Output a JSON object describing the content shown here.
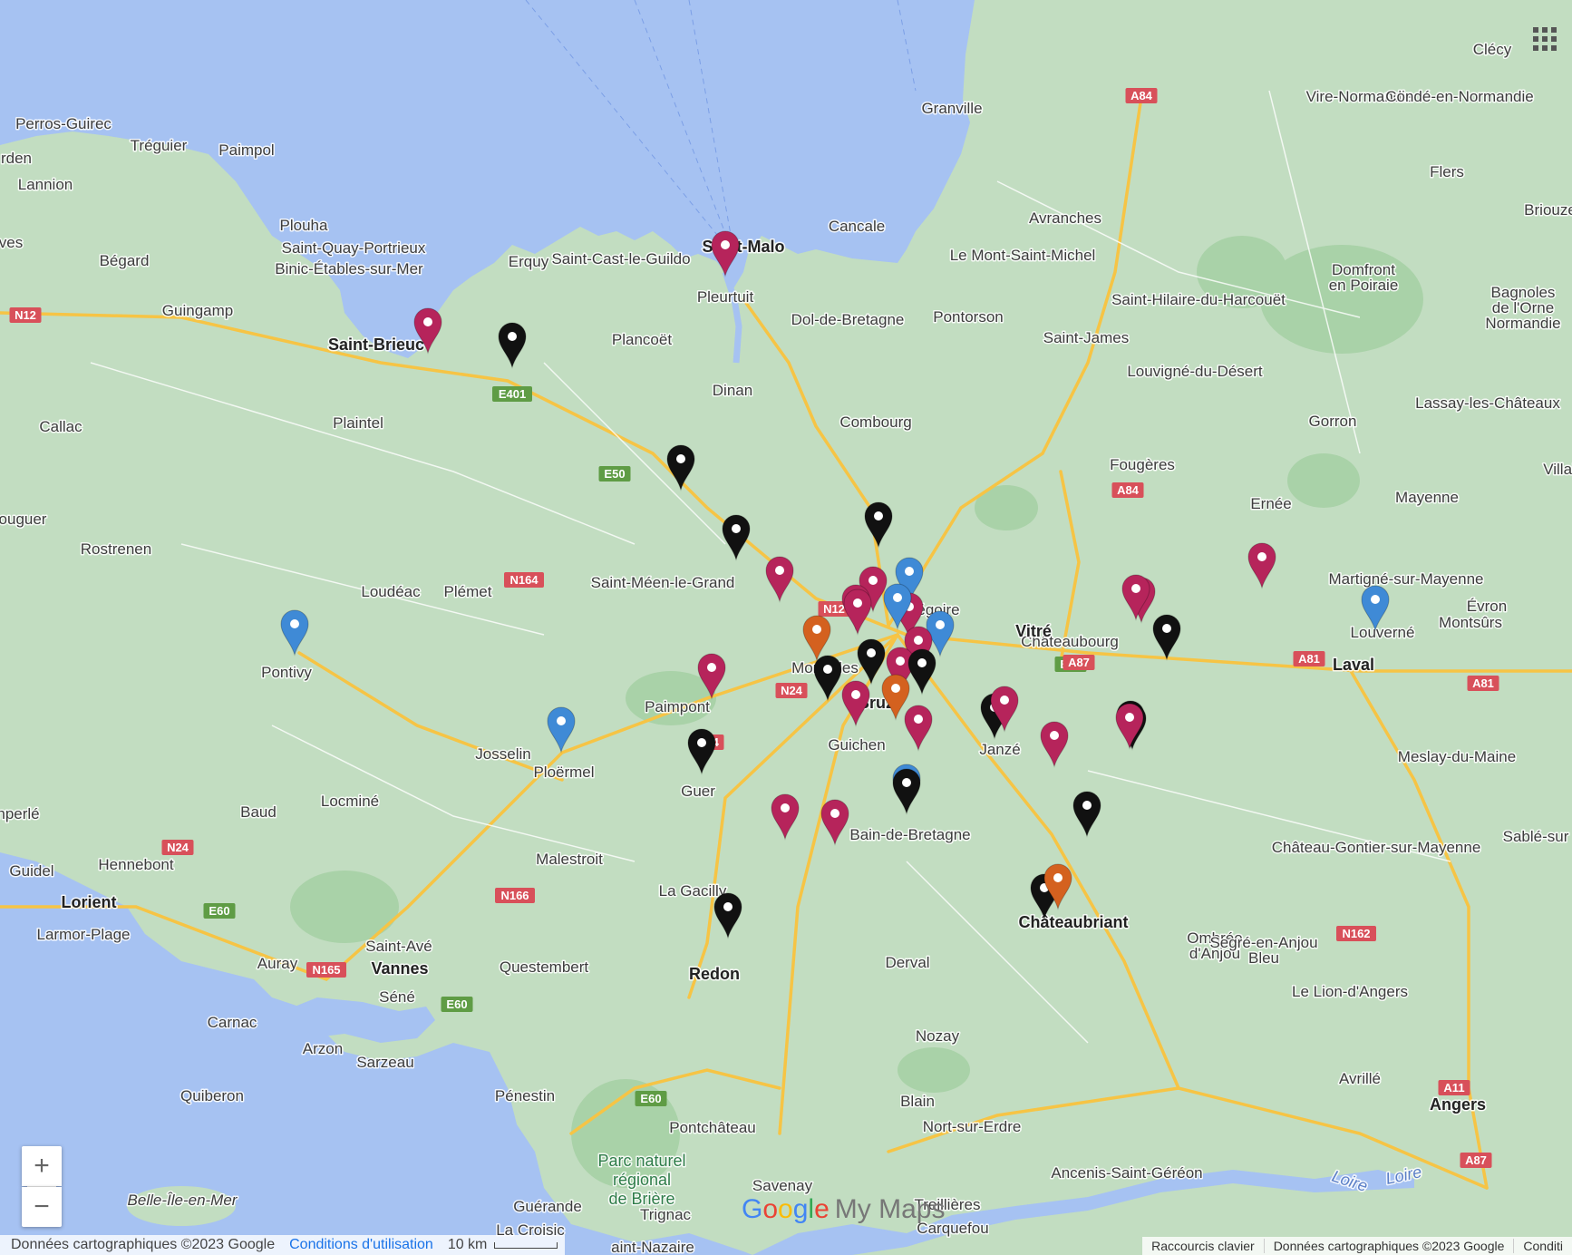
{
  "map": {
    "attribution": "Données cartographiques ©2023 Google",
    "terms_link": "Conditions d'utilisation",
    "scale_label": "10 km",
    "keyboard_shortcuts": "Raccourcis clavier",
    "attribution_right": "Données cartographiques ©2023 Google",
    "terms_right": "Conditi",
    "zoom_in": "+",
    "zoom_out": "−",
    "logo_google": "Google",
    "logo_mymaps": "My Maps",
    "marker_colors": {
      "magenta": "#b6245b",
      "black": "#111111",
      "blue": "#3f8ad6",
      "orange": "#d4611f"
    },
    "places": [
      "Perros-Guirec",
      "Tréguier",
      "Paimpol",
      "rden",
      "Lannion",
      "Plouha",
      "Saint-Quay-Portrieux",
      "Binic-Étables-sur-Mer",
      "Bégard",
      "ves",
      "Guingamp",
      "Erquy",
      "Saint-Cast-le-Guildo",
      "Saint-Malo",
      "Cancale",
      "Granville",
      "Avranches",
      "Le Mont-Saint-Michel",
      "Pleurtuit",
      "Saint-Brieuc",
      "Plancoët",
      "Dol-de-Bretagne",
      "Pontorson",
      "Saint-James",
      "Saint-Hilaire-du-Harcouët",
      "Dinan",
      "Callac",
      "Plaintel",
      "Combourg",
      "Louvigné-du-Désert",
      "Lassay-les-Châteaux",
      "Gorron",
      "Fougères",
      "Villai",
      "Ernée",
      "Mayenne",
      "ouguer",
      "Rostrenen",
      "Loudéac",
      "Plémet",
      "Saint-Méen-le-Grand",
      "égoire",
      "Châteaubourg",
      "Vitré",
      "Martigné-sur-Mayenne",
      "Évron",
      "Montsûrs",
      "Louverné",
      "Laval",
      "Pontivy",
      "Mordelles",
      "Paimpont",
      "Bruz",
      "Guichen",
      "Janzé",
      "Josselin",
      "Ploërmel",
      "Guer",
      "Locminé",
      "Baud",
      "nperlé",
      "Meslay-du-Maine",
      "Bain-de-Bretagne",
      "Sablé-sur",
      "Hennebont",
      "Guidel",
      "Lorient",
      "Malestroit",
      "La Gacilly",
      "Château-Gontier-sur-Mayenne",
      "Larmor-Plage",
      "Châteaubriant",
      "Ombrée d'Anjou",
      "Segré-en-Anjou Bleu",
      "Saint-Avé",
      "Auray",
      "Vannes",
      "Questembert",
      "Redon",
      "Derval",
      "Séné",
      "Le Lion-d'Angers",
      "Carnac",
      "Arzon",
      "Sarzeau",
      "Nozay",
      "Quiberon",
      "Pénestin",
      "Avrillé",
      "Angers",
      "Blain",
      "Nort-sur-Erdre",
      "Pontchâteau",
      "Ancenis-Saint-Géréon",
      "Savenay",
      "Belle-Île-en-Mer",
      "Guérande",
      "Trignac",
      "Treillières",
      "Carquefou",
      "La Croisic",
      "aint-Nazaire",
      "Clécy",
      "Vire-Normandie",
      "Condé-en-Normandie",
      "Flers",
      "Briouze",
      "Domfront en Poiraie",
      "Bagnoles de l'Orne Normandie"
    ],
    "roads": [
      "A84",
      "N12",
      "E401",
      "E50",
      "N164",
      "N12",
      "N24",
      "N24",
      "E50",
      "A84",
      "A81",
      "A81",
      "N24",
      "E60",
      "N165",
      "E60",
      "N166",
      "E60",
      "N162",
      "A11",
      "A87",
      "A87"
    ],
    "park_label": "Parc naturel régional de Brière",
    "river_label": "Loire",
    "markers": [
      {
        "color": "magenta"
      },
      {
        "color": "magenta"
      },
      {
        "color": "black"
      },
      {
        "color": "black"
      },
      {
        "color": "black"
      },
      {
        "color": "black"
      },
      {
        "color": "blue"
      },
      {
        "color": "magenta"
      },
      {
        "color": "magenta"
      },
      {
        "color": "magenta"
      },
      {
        "color": "magenta"
      },
      {
        "color": "blue"
      },
      {
        "color": "blue"
      },
      {
        "color": "magenta"
      },
      {
        "color": "magenta"
      },
      {
        "color": "orange"
      },
      {
        "color": "black"
      },
      {
        "color": "black"
      },
      {
        "color": "magenta"
      },
      {
        "color": "black"
      },
      {
        "color": "orange"
      },
      {
        "color": "magenta"
      },
      {
        "color": "black"
      },
      {
        "color": "magenta"
      },
      {
        "color": "blue"
      },
      {
        "color": "black"
      },
      {
        "color": "black"
      },
      {
        "color": "magenta"
      },
      {
        "color": "magenta"
      },
      {
        "color": "magenta"
      },
      {
        "color": "blue"
      },
      {
        "color": "black"
      },
      {
        "color": "magenta"
      },
      {
        "color": "magenta"
      },
      {
        "color": "black"
      },
      {
        "color": "magenta"
      },
      {
        "color": "black"
      },
      {
        "color": "black"
      },
      {
        "color": "magenta"
      },
      {
        "color": "black"
      },
      {
        "color": "orange"
      },
      {
        "color": "black"
      },
      {
        "color": "magenta"
      },
      {
        "color": "blue"
      },
      {
        "color": "magenta"
      },
      {
        "color": "blue"
      },
      {
        "color": "black"
      }
    ]
  }
}
